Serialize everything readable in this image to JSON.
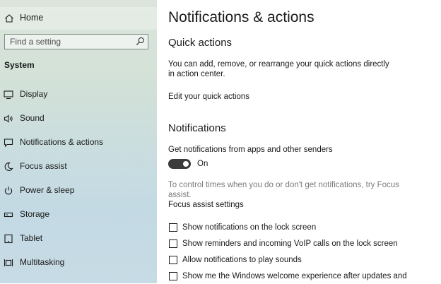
{
  "sidebar": {
    "home_label": "Home",
    "search_placeholder": "Find a setting",
    "section_title": "System",
    "items": [
      {
        "label": "Display",
        "icon": "monitor-icon"
      },
      {
        "label": "Sound",
        "icon": "speaker-icon"
      },
      {
        "label": "Notifications & actions",
        "icon": "message-icon"
      },
      {
        "label": "Focus assist",
        "icon": "moon-icon"
      },
      {
        "label": "Power & sleep",
        "icon": "power-icon"
      },
      {
        "label": "Storage",
        "icon": "storage-icon"
      },
      {
        "label": "Tablet",
        "icon": "tablet-icon"
      },
      {
        "label": "Multitasking",
        "icon": "multitasking-icon"
      }
    ]
  },
  "main": {
    "title": "Notifications & actions",
    "quick_actions": {
      "heading": "Quick actions",
      "description": "You can add, remove, or rearrange your quick actions directly in action center.",
      "edit_link": "Edit your quick actions"
    },
    "notifications": {
      "heading": "Notifications",
      "get_label": "Get notifications from apps and other senders",
      "toggle_state": "On",
      "toggle_on": true,
      "focus_hint": "To control times when you do or don't get notifications, try Focus assist.",
      "focus_link": "Focus assist settings",
      "checkboxes": [
        {
          "label": "Show notifications on the lock screen",
          "checked": false
        },
        {
          "label": "Show reminders and incoming VoIP calls on the lock screen",
          "checked": false
        },
        {
          "label": "Allow notifications to play sounds",
          "checked": false
        },
        {
          "label": "Show me the Windows welcome experience after updates and",
          "checked": false
        }
      ]
    }
  }
}
